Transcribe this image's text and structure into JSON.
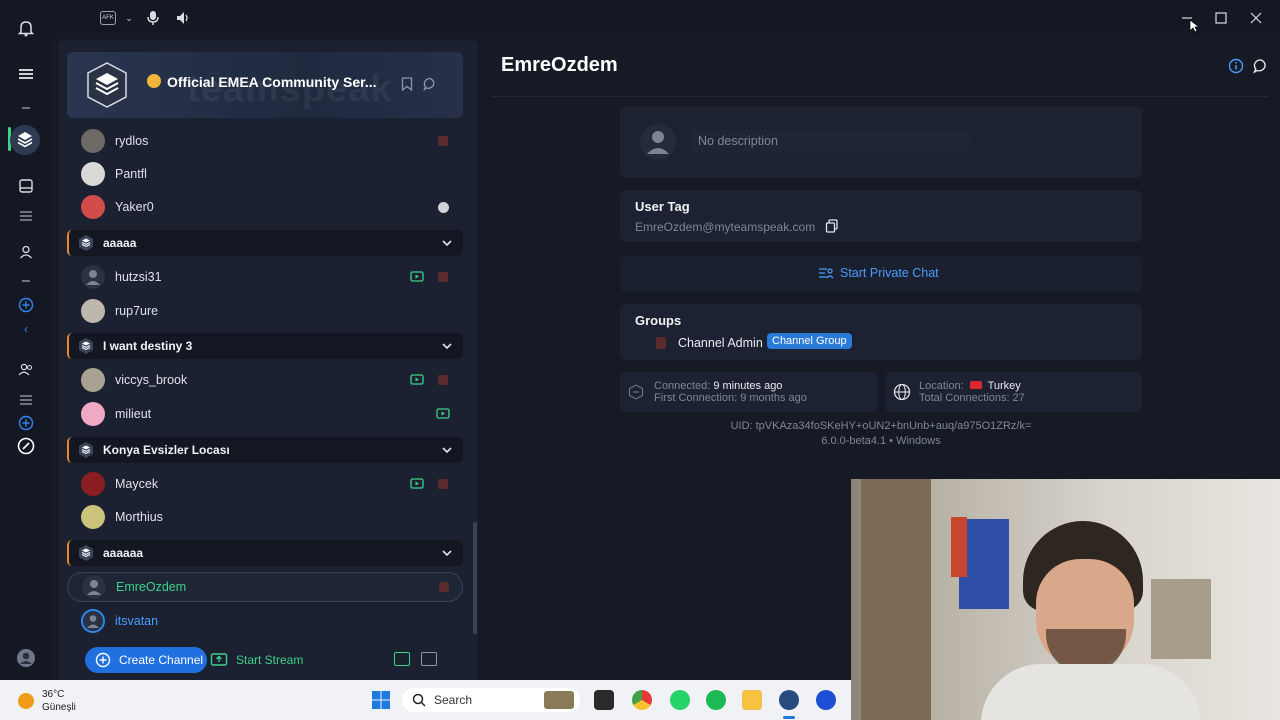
{
  "titlebar": {
    "afk_label": "AFK"
  },
  "server": {
    "name": "Official EMEA Community Ser...",
    "watermark": "teamspeak"
  },
  "users_top": [
    {
      "name": "rydlos"
    },
    {
      "name": "Pantfl"
    },
    {
      "name": "Yaker0"
    }
  ],
  "channels": [
    {
      "name": "aaaaa",
      "users": [
        {
          "name": "hutzsi31"
        },
        {
          "name": "rup7ure"
        }
      ]
    },
    {
      "name": "I want destiny 3",
      "users": [
        {
          "name": "viccys_brook"
        },
        {
          "name": "milieut"
        }
      ]
    },
    {
      "name": "Konya Evsizler Locası",
      "users": [
        {
          "name": "Maycek"
        },
        {
          "name": "Morthius"
        }
      ]
    },
    {
      "name": "aaaaaa",
      "users": [
        {
          "name": "EmreOzdem"
        },
        {
          "name": "itsvatan"
        }
      ]
    }
  ],
  "bottom": {
    "create_channel": "Create Channel",
    "start_stream": "Start Stream"
  },
  "profile": {
    "name": "EmreOzdem",
    "description_placeholder": "No description",
    "user_tag_label": "User Tag",
    "user_tag": "EmreOzdem@myteamspeak.com",
    "private_chat": "Start Private Chat",
    "groups_label": "Groups",
    "group_name": "Channel Admin",
    "group_badge": "Channel Group",
    "connected_label": "Connected:",
    "connected_value": "9 minutes ago",
    "first_connection": "First Connection: 9 months ago",
    "location_label": "Location:",
    "location_value": "Turkey",
    "total_connections": "Total Connections: 27",
    "uid_line": "UID: tpVKAza34foSKeHY+oUN2+bnUnb+auq/a975O1ZRz/k=",
    "version_line": "6.0.0-beta4.1 • Windows"
  },
  "taskbar": {
    "temperature": "36°C",
    "weather": "Güneşli",
    "search": "Search"
  },
  "colors": {
    "accent_blue": "#2070e0",
    "accent_green": "#3fd089",
    "channel_border": "#e68a2e"
  }
}
